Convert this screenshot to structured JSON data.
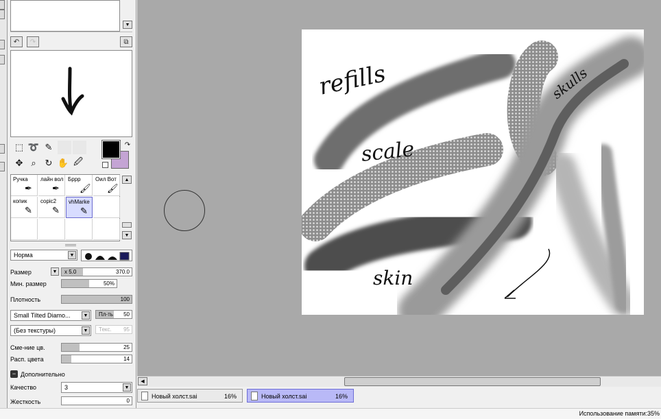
{
  "brushes": [
    {
      "name": "Ручка"
    },
    {
      "name": "лайн вол"
    },
    {
      "name": "Бррр"
    },
    {
      "name": "Оил Вот"
    },
    {
      "name": "копик"
    },
    {
      "name": "copic2"
    },
    {
      "name": "vhMarke"
    }
  ],
  "blend_mode": "Норма",
  "size": {
    "label": "Размер",
    "multiplier": "x 5.0",
    "value": "370.0"
  },
  "min_size": {
    "label": "Мин. размер",
    "value": "50%",
    "fraction": 0.5
  },
  "density": {
    "label": "Плотность",
    "value": "100",
    "fraction": 1.0
  },
  "shape": {
    "value": "Small Tilted Diamo...",
    "prop_label": "Пл-ть",
    "prop_value": "50"
  },
  "texture": {
    "value": "(Без текстуры)",
    "prop_label": "Текс.",
    "prop_value": "95"
  },
  "color_mix": {
    "label": "Сме-ние цв.",
    "value": "25",
    "fraction": 0.25
  },
  "color_spread": {
    "label": "Расп. цвета",
    "value": "14",
    "fraction": 0.14
  },
  "advanced": {
    "label": "Дополнительно"
  },
  "quality": {
    "label": "Качество",
    "value": "3"
  },
  "hardness": {
    "label": "Жесткость",
    "value": "0"
  },
  "tabs": [
    {
      "name": "Новый холст.sai",
      "zoom": "16%",
      "active": false
    },
    {
      "name": "Новый холст.sai",
      "zoom": "16%",
      "active": true
    }
  ],
  "canvas_text": {
    "refills": "refills",
    "scale": "scale",
    "skin": "skin",
    "skulls": "skulls"
  },
  "status": {
    "memory": "Использование памяти:35%"
  },
  "colors": {
    "primary": "#000000",
    "secondary": "#c4a4d4",
    "workspace": "#a9a9a9",
    "tab_active": "#b9b9f7"
  },
  "icons": [
    "undo-icon",
    "redo-icon",
    "rect-select-icon",
    "lasso-icon",
    "magic-wand-icon",
    "move-icon",
    "zoom-icon",
    "rotate-icon",
    "hand-icon",
    "eyedropper-icon",
    "pen-icon",
    "doc-icon"
  ]
}
